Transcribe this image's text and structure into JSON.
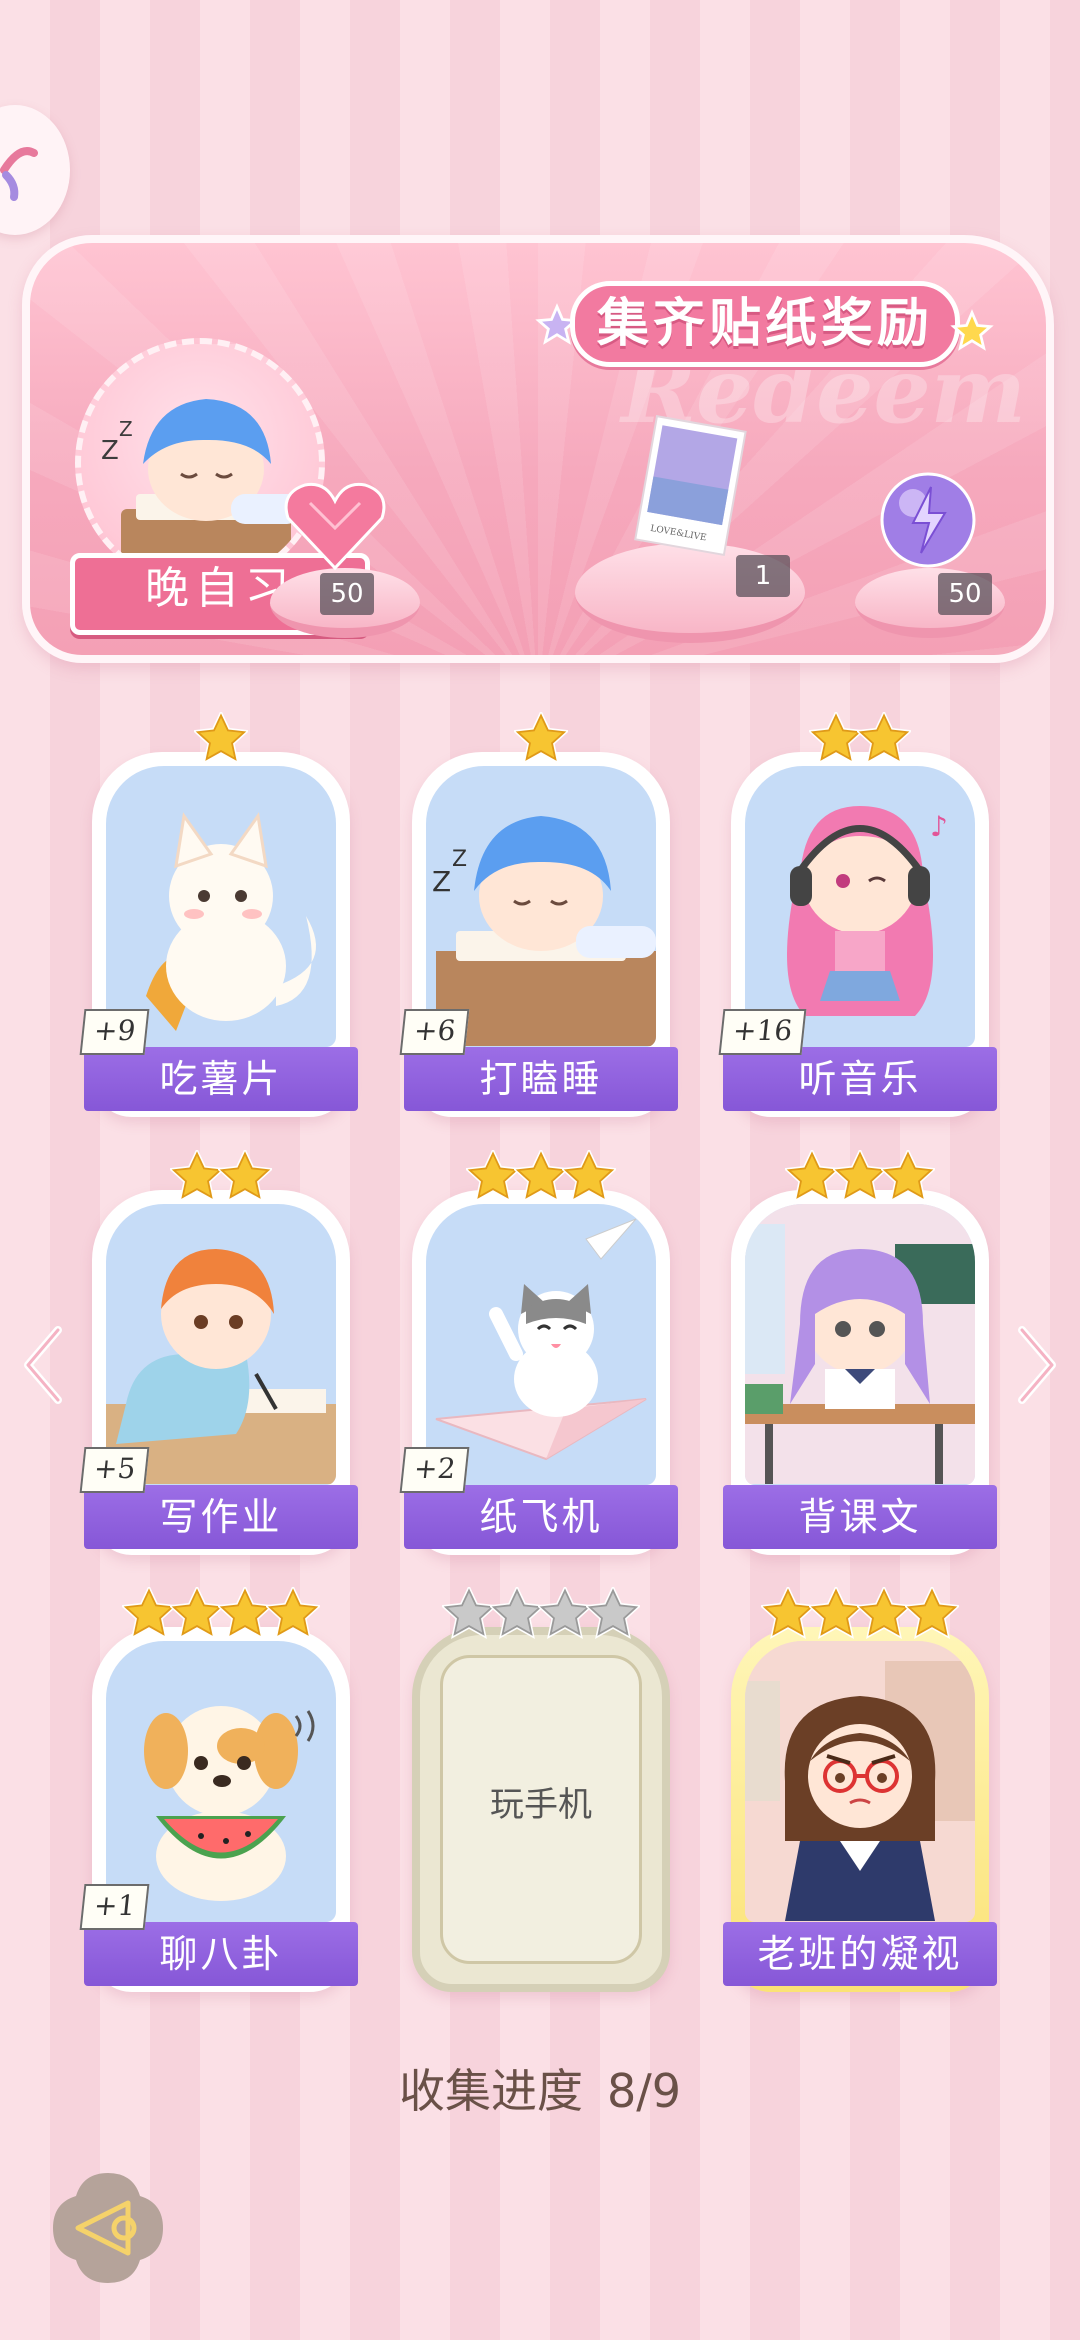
{
  "banner": {
    "title": "集齐贴纸奖励",
    "watermark": "Redeem",
    "theme_label": "晚自习",
    "rewards": [
      {
        "icon": "pink-heart-gem-icon",
        "count": "50"
      },
      {
        "icon": "photo-card-icon",
        "count": "1"
      },
      {
        "icon": "purple-energy-orb-icon",
        "count": "50"
      }
    ]
  },
  "stickers": [
    {
      "name": "吃薯片",
      "stars": 1,
      "bonus": "+9",
      "art": "white-fox-eating-chips"
    },
    {
      "name": "打瞌睡",
      "stars": 1,
      "bonus": "+6",
      "art": "boy-sleeping-on-desk"
    },
    {
      "name": "听音乐",
      "stars": 2,
      "bonus": "+16",
      "art": "girl-with-headphones"
    },
    {
      "name": "写作业",
      "stars": 2,
      "bonus": "+5",
      "art": "boy-writing-homework"
    },
    {
      "name": "纸飞机",
      "stars": 3,
      "bonus": "+2",
      "art": "cat-on-paper-plane"
    },
    {
      "name": "背课文",
      "stars": 3,
      "bonus": "",
      "art": "girl-in-classroom"
    },
    {
      "name": "聊八卦",
      "stars": 4,
      "bonus": "+1",
      "art": "puppy-eating-watermelon"
    },
    {
      "name": "玩手机",
      "stars": 4,
      "bonus": "",
      "art": "locked",
      "locked": true
    },
    {
      "name": "老班的凝视",
      "stars": 4,
      "bonus": "",
      "art": "teacher-glare",
      "rare": true
    }
  ],
  "progress": {
    "label": "收集进度",
    "value": "8/9",
    "collected": 8,
    "total": 9
  },
  "colors": {
    "accent_pink": "#f27aa0",
    "label_purple": "#8657d7",
    "star_gold": "#f7c531",
    "star_grey": "#c9c9c9"
  }
}
